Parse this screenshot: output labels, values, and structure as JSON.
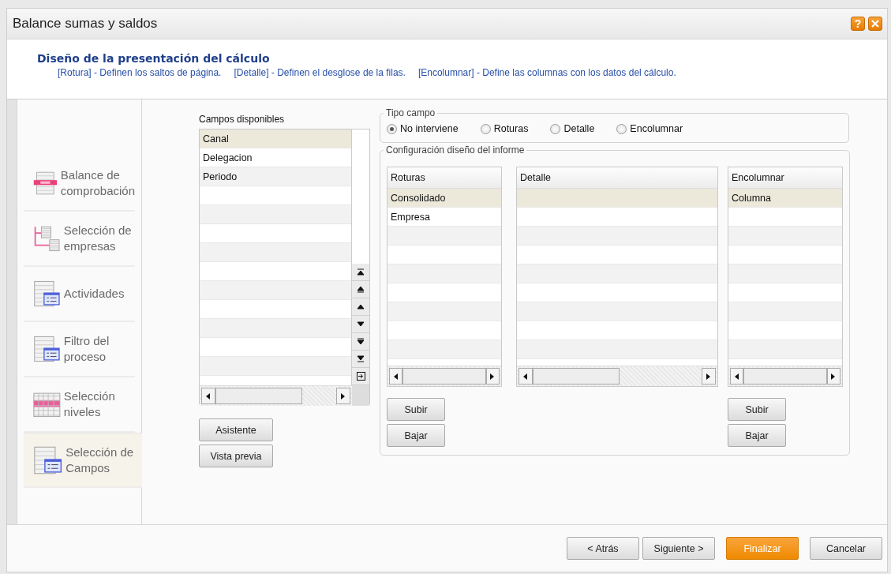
{
  "window": {
    "title": "Balance sumas y saldos",
    "help_button": "?"
  },
  "header": {
    "title": "Diseño de la presentación del cálculo",
    "hints": [
      "[Rotura] - Definen los saltos de página.",
      "[Detalle] - Definen el desglose de la filas.",
      "[Encolumnar] - Define las columnas con los datos del cálculo."
    ]
  },
  "steps": [
    {
      "label": "Balance de comprobación",
      "kind": "balance",
      "selected": false
    },
    {
      "label": "Selección de empresas",
      "kind": "tree",
      "selected": false
    },
    {
      "label": "Actividades",
      "kind": "form",
      "selected": false
    },
    {
      "label": "Filtro del proceso",
      "kind": "form",
      "selected": false
    },
    {
      "label": "Selección niveles",
      "kind": "grid",
      "selected": false
    },
    {
      "label": "Selección de Campos",
      "kind": "form",
      "selected": true
    }
  ],
  "available_fields": {
    "title": "Campos disponibles",
    "items": [
      {
        "label": "Canal",
        "selected": true
      },
      {
        "label": "Delegacion",
        "selected": false
      },
      {
        "label": "Periodo",
        "selected": false
      }
    ],
    "buttons": [
      "Asistente",
      "Vista previa"
    ]
  },
  "field_type": {
    "legend": "Tipo campo",
    "options": [
      {
        "label": "No interviene",
        "selected": true
      },
      {
        "label": "Roturas",
        "selected": false
      },
      {
        "label": "Detalle",
        "selected": false
      },
      {
        "label": "Encolumnar",
        "selected": false
      }
    ]
  },
  "report_design": {
    "legend": "Configuración diseño del informe",
    "grids": [
      {
        "header": "Roturas",
        "rows": [
          {
            "label": "Consolidado",
            "selected": true
          },
          {
            "label": "Empresa",
            "selected": false
          }
        ],
        "buttons": [
          "Subir",
          "Bajar"
        ]
      },
      {
        "header": "Detalle",
        "empty_row_selected": true
      },
      {
        "header": "Encolumnar",
        "rows": [
          {
            "label": "Columna",
            "selected": true
          }
        ],
        "buttons": [
          "Subir",
          "Bajar"
        ]
      }
    ]
  },
  "footer_buttons": [
    {
      "label": "< Atrás",
      "kind": "normal"
    },
    {
      "label": "Siguiente >",
      "kind": "normal"
    },
    {
      "label": "Finalizar",
      "kind": "primary"
    },
    {
      "label": "Cancelar",
      "kind": "normal"
    }
  ]
}
